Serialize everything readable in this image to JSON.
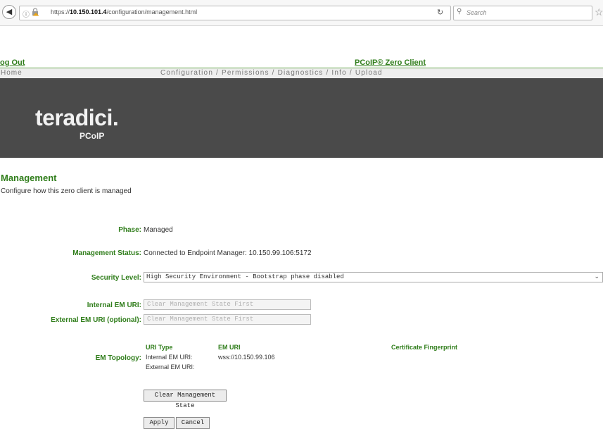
{
  "browser": {
    "url_prefix": "https://",
    "url_host": "10.150.101.4",
    "url_path": "/configuration/management.html",
    "search_placeholder": "Search"
  },
  "header": {
    "logout": "og Out",
    "product": "PCoIP® Zero Client",
    "nav_home": "Home",
    "nav_links": "Configuration / Permissions / Diagnostics / Info / Upload",
    "brand": "teradici.",
    "brand_sub": "PCoIP"
  },
  "page": {
    "title": "Management",
    "subtitle": "Configure how this zero client is managed"
  },
  "form": {
    "phase_label": "Phase:",
    "phase_value": "Managed",
    "status_label": "Management Status:",
    "status_value": "Connected to Endpoint Manager: 10.150.99.106:5172",
    "security_label": "Security Level:",
    "security_value": "High Security Environment - Bootstrap phase disabled",
    "internal_label": "Internal EM URI:",
    "internal_placeholder": "Clear Management State First",
    "external_label": "External EM URI (optional):",
    "external_placeholder": "Clear Management State First",
    "topology_label": "EM Topology:",
    "topology": {
      "headers": [
        "URI Type",
        "EM URI",
        "Certificate Fingerprint"
      ],
      "rows": [
        {
          "type": "Internal EM URI:",
          "uri": "wss://10.150.99.106"
        },
        {
          "type": "External EM URI:",
          "uri": ""
        }
      ]
    },
    "clear_button": "Clear Management State",
    "apply_button": "Apply",
    "cancel_button": "Cancel"
  }
}
